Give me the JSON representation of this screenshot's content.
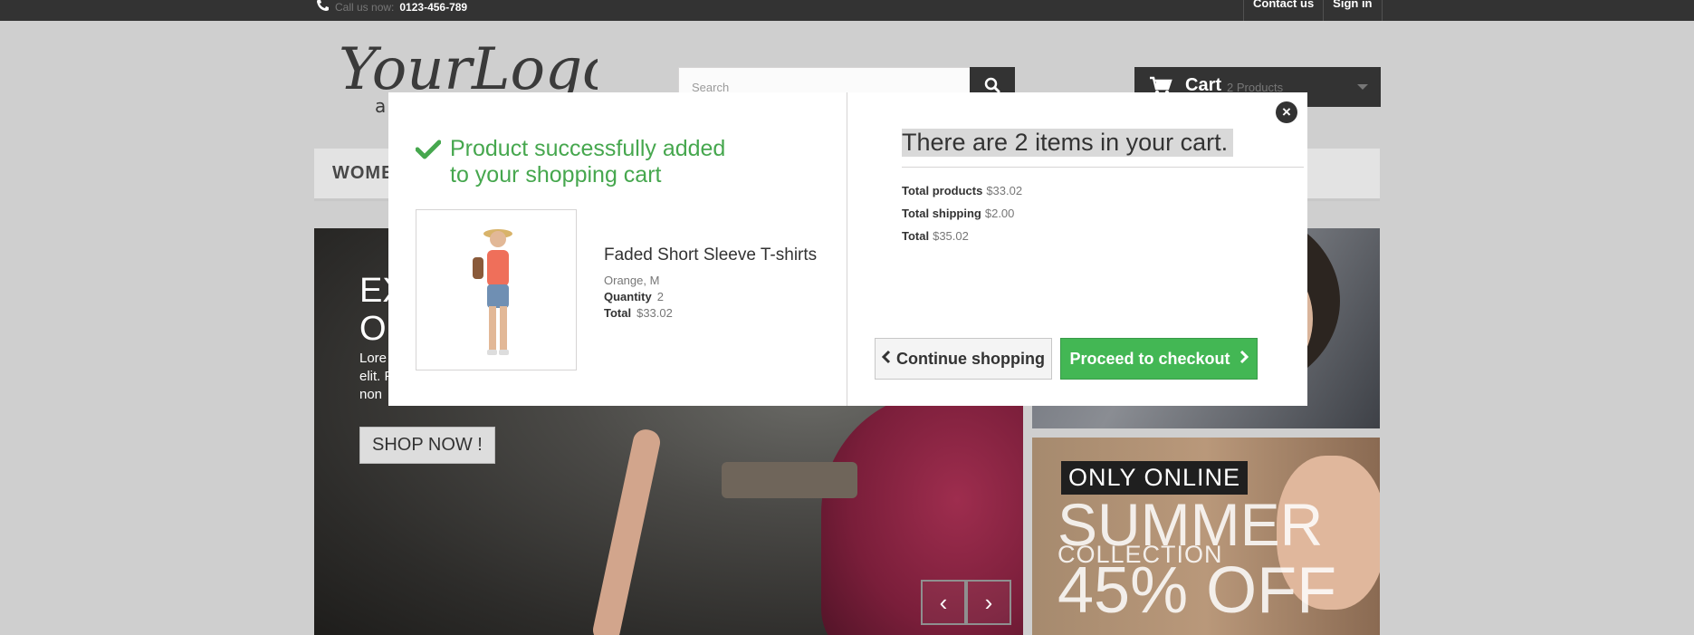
{
  "topbar": {
    "call_label": "Call us now:",
    "phone": "0123-456-789",
    "contact_label": "Contact us",
    "signin_label": "Sign in"
  },
  "header": {
    "logo_text": "YourLogo",
    "search_placeholder": "Search",
    "cart_label": "Cart",
    "cart_count": "2 Products"
  },
  "menu": {
    "visible_item": "WOMEN"
  },
  "slider": {
    "title_line1": "EX",
    "title_line2": "O",
    "text_line1": "Lore",
    "text_line2": "elit. F",
    "text_line3": "non",
    "shop_label": "SHOP NOW !"
  },
  "banner": {
    "only_online": "ONLY ONLINE",
    "summer": "SUMMER",
    "collection": "COLLECTION",
    "discount": "45% OFF"
  },
  "modal": {
    "added_title": "Product successfully added to your shopping cart",
    "product_name": "Faded Short Sleeve T-shirts",
    "product_attributes": "Orange, M",
    "quantity_label": "Quantity",
    "quantity": "2",
    "total_label": "Total",
    "total": "$33.02",
    "cart_heading": "There are 2 items in your cart.",
    "total_products_label": "Total products",
    "total_products": "$33.02",
    "total_shipping_label": "Total shipping",
    "total_shipping": "$2.00",
    "grand_total_label": "Total",
    "grand_total": "$35.02",
    "continue_label": "Continue shopping",
    "proceed_label": "Proceed to checkout"
  },
  "colors": {
    "success_green": "#46a74e",
    "button_green": "#43b754",
    "dark": "#333333"
  }
}
